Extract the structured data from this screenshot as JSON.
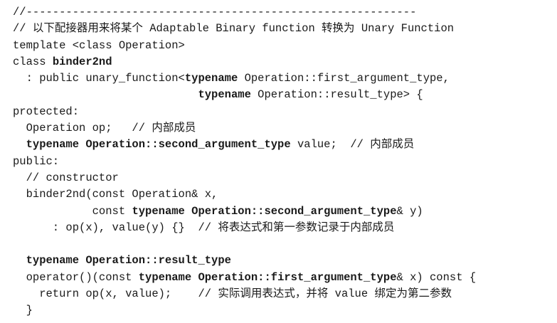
{
  "code_lines": [
    [
      {
        "t": "//-----------------------------------------------------------",
        "b": false
      }
    ],
    [
      {
        "t": "// 以下配接器用来将某个 Adaptable Binary function 转换为 Unary Function",
        "b": false
      }
    ],
    [
      {
        "t": "template <class Operation>",
        "b": false
      }
    ],
    [
      {
        "t": "class ",
        "b": false
      },
      {
        "t": "binder2nd",
        "b": true
      }
    ],
    [
      {
        "t": "  : public unary_function<",
        "b": false
      },
      {
        "t": "typename",
        "b": true
      },
      {
        "t": " Operation::first_argument_type,",
        "b": false
      }
    ],
    [
      {
        "t": "                            ",
        "b": false
      },
      {
        "t": "typename",
        "b": true
      },
      {
        "t": " Operation::result_type> {",
        "b": false
      }
    ],
    [
      {
        "t": "protected:",
        "b": false
      }
    ],
    [
      {
        "t": "  Operation op;   // 内部成员",
        "b": false
      }
    ],
    [
      {
        "t": "  typename Operation::second_argument_type",
        "b": true
      },
      {
        "t": " value;  // 内部成员",
        "b": false
      }
    ],
    [
      {
        "t": "public:",
        "b": false
      }
    ],
    [
      {
        "t": "  // constructor",
        "b": false
      }
    ],
    [
      {
        "t": "  binder2nd(const Operation& x,",
        "b": false
      }
    ],
    [
      {
        "t": "            const ",
        "b": false
      },
      {
        "t": "typename Operation::second_argument_type",
        "b": true
      },
      {
        "t": "& y)",
        "b": false
      }
    ],
    [
      {
        "t": "      : op(x), value(y) {}  // 将表达式和第一参数记录于内部成员",
        "b": false
      }
    ],
    [
      {
        "t": "",
        "b": false
      }
    ],
    [
      {
        "t": "  typename Operation::result_type",
        "b": true
      }
    ],
    [
      {
        "t": "  operator()(const ",
        "b": false
      },
      {
        "t": "typename Operation::first_argument_type",
        "b": true
      },
      {
        "t": "& x) const {",
        "b": false
      }
    ],
    [
      {
        "t": "    return op(x, value);    // 实际调用表达式，并将 value 绑定为第二参数",
        "b": false
      }
    ],
    [
      {
        "t": "  }",
        "b": false
      }
    ]
  ]
}
